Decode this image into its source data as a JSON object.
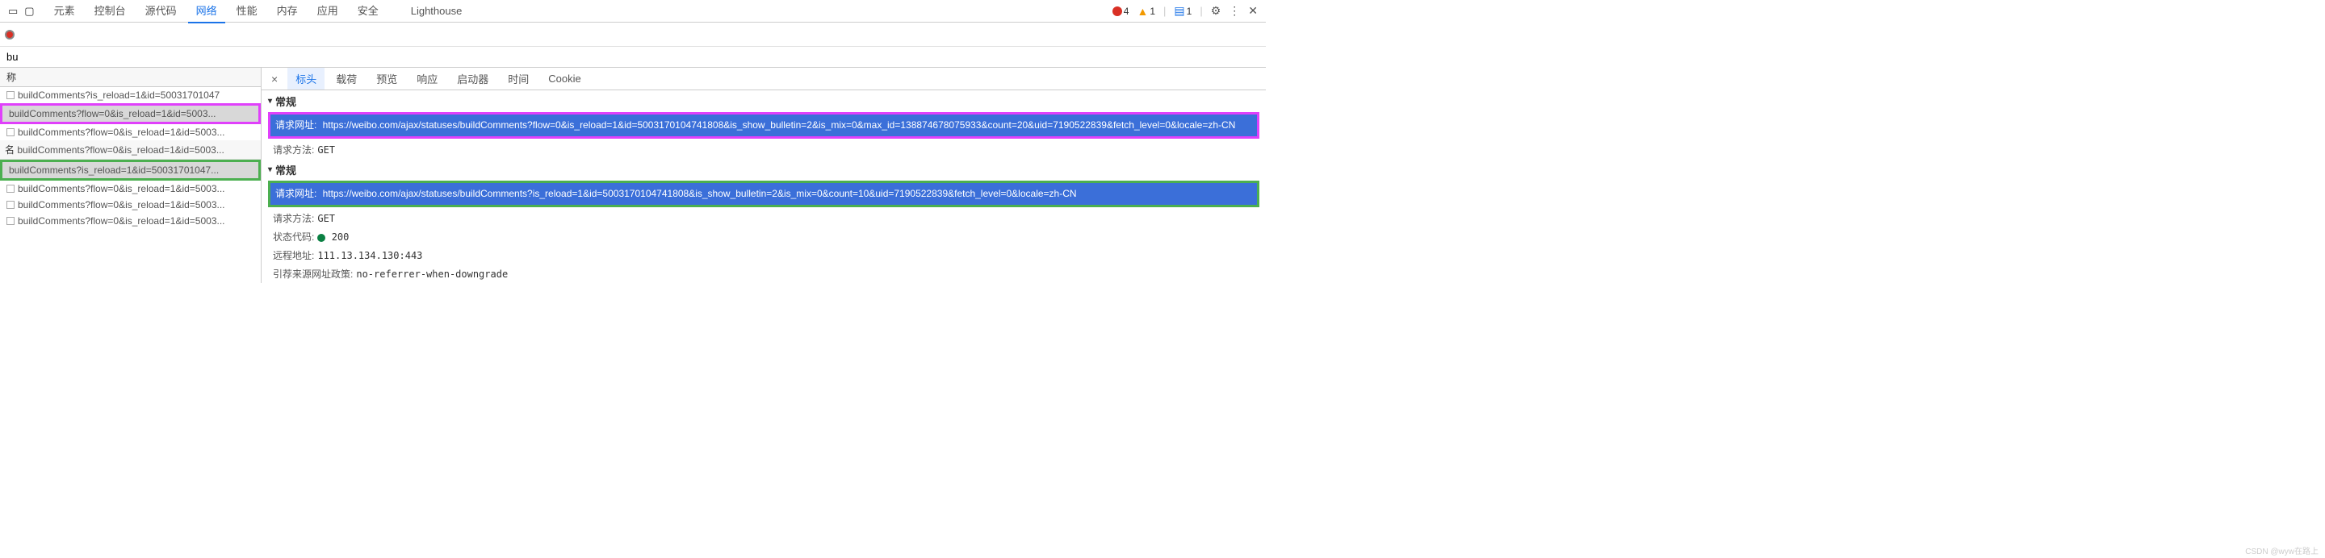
{
  "toolbar": {
    "tabs": [
      "元素",
      "控制台",
      "源代码",
      "网络",
      "性能",
      "内存",
      "应用",
      "安全"
    ],
    "active_tab": "网络",
    "lighthouse": "Lighthouse",
    "errors": "4",
    "warnings": "1",
    "messages": "1"
  },
  "filter": {
    "value": "bu"
  },
  "col_header": "称",
  "name_label": "名",
  "requests": [
    {
      "name": "buildComments?is_reload=1&id=50031701047",
      "hl": ""
    },
    {
      "name": "buildComments?flow=0&is_reload=1&id=5003...",
      "hl": "mag"
    },
    {
      "name": "buildComments?flow=0&is_reload=1&id=5003...",
      "hl": ""
    },
    {
      "name": "buildComments?flow=0&is_reload=1&id=5003...",
      "hl": ""
    },
    {
      "name": "buildComments?is_reload=1&id=50031701047...",
      "hl": "grn"
    },
    {
      "name": "buildComments?flow=0&is_reload=1&id=5003...",
      "hl": ""
    },
    {
      "name": "buildComments?flow=0&is_reload=1&id=5003...",
      "hl": ""
    },
    {
      "name": "buildComments?flow=0&is_reload=1&id=5003...",
      "hl": ""
    }
  ],
  "detail_tabs": [
    "标头",
    "载荷",
    "预览",
    "响应",
    "启动器",
    "时间",
    "Cookie"
  ],
  "detail_active": "标头",
  "section1": {
    "title": "常规",
    "url_label": "请求网址:",
    "url": "https://weibo.com/ajax/statuses/buildComments?flow=0&is_reload=1&id=5003170104741808&is_show_bulletin=2&is_mix=0&max_id=138874678075933&count=20&uid=7190522839&fetch_level=0&locale=zh-CN",
    "method_label": "请求方法:",
    "method": "GET"
  },
  "section2": {
    "title": "常规",
    "url_label": "请求网址:",
    "url": "https://weibo.com/ajax/statuses/buildComments?is_reload=1&id=5003170104741808&is_show_bulletin=2&is_mix=0&count=10&uid=7190522839&fetch_level=0&locale=zh-CN",
    "method_label": "请求方法:",
    "method": "GET",
    "status_label": "状态代码:",
    "status": "200",
    "remote_label": "远程地址:",
    "remote": "111.13.134.130:443",
    "referrer_label": "引荐来源网址政策:",
    "referrer": "no-referrer-when-downgrade"
  },
  "watermark": "CSDN @wyw在路上"
}
